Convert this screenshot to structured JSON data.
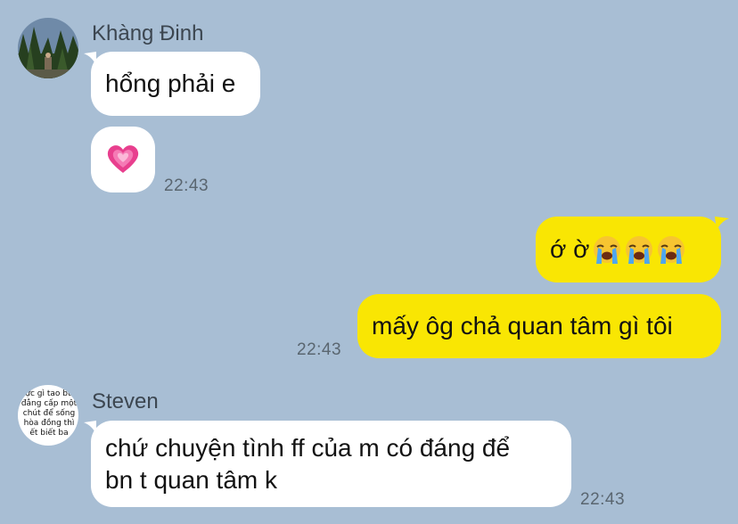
{
  "messages": {
    "m1": {
      "sender": "Khàng Đinh",
      "text": "hổng phải e"
    },
    "m2": {
      "icon": "pink-heart-icon",
      "time": "22:43"
    },
    "m3": {
      "text": "ớ ờ",
      "icons": [
        "crying-face-icon",
        "crying-face-icon",
        "crying-face-icon"
      ]
    },
    "m4": {
      "text": "mấy ôg chả quan tâm gì tôi",
      "time": "22:43"
    },
    "m5": {
      "sender": "Steven",
      "lines": [
        "chứ chuyện tình ff của m có đáng để",
        "bn t quan tâm k"
      ],
      "time": "22:43"
    }
  },
  "avatars": {
    "steven_avatar_text": [
      "ực gì tao bu",
      "đẳng cấp một",
      "chút để sống",
      "hòa đồng thì",
      "ết biết ba"
    ]
  },
  "colors": {
    "background": "#a8bed4",
    "incoming_bubble": "#ffffff",
    "outgoing_bubble": "#f9e603",
    "timestamp": "#5a6670"
  }
}
